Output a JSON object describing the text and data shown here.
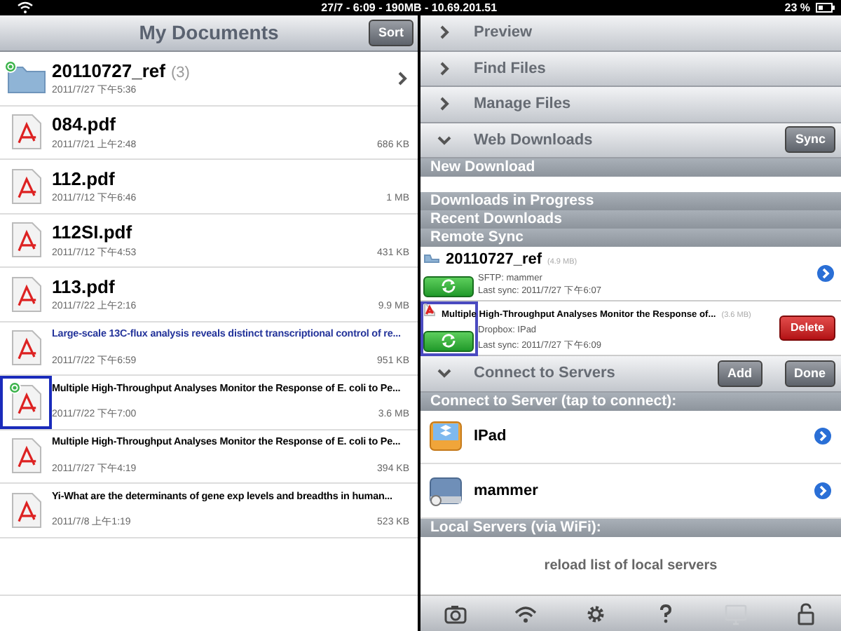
{
  "status_bar": {
    "time": "27/7 - 6:09 - 190MB - 10.69.201.51",
    "battery": "23 %"
  },
  "documents": {
    "title": "My Documents",
    "sort_button": "Sort",
    "items": [
      {
        "kind": "folder",
        "name": "20110727_ref",
        "count": "(3)",
        "date": "2011/7/27 下午5:36",
        "synced": true,
        "selected": false,
        "highlighted": false
      },
      {
        "kind": "pdf",
        "name": "084.pdf",
        "date": "2011/7/21 上午2:48",
        "size": "686 KB",
        "synced": false,
        "selected": false,
        "highlighted": false
      },
      {
        "kind": "pdf",
        "name": "112.pdf",
        "date": "2011/7/12 下午6:46",
        "size": "1 MB",
        "synced": false,
        "selected": false,
        "highlighted": false
      },
      {
        "kind": "pdf",
        "name": "112SI.pdf",
        "date": "2011/7/12 下午4:53",
        "size": "431 KB",
        "synced": false,
        "selected": false,
        "highlighted": false
      },
      {
        "kind": "pdf",
        "name": "113.pdf",
        "date": "2011/7/22 上午2:16",
        "size": "9.9 MB",
        "synced": false,
        "selected": false,
        "highlighted": false
      },
      {
        "kind": "pdf",
        "name": "Large-scale 13C-flux analysis reveals distinct transcriptional control of re...",
        "date": "2011/7/22 下午6:59",
        "size": "951 KB",
        "synced": false,
        "selected": false,
        "highlighted": true
      },
      {
        "kind": "pdf",
        "name": "Multiple High-Throughput Analyses Monitor the Response of E. coli to Pe...",
        "date": "2011/7/22 下午7:00",
        "size": "3.6 MB",
        "synced": true,
        "selected": true,
        "highlighted": false
      },
      {
        "kind": "pdf",
        "name": "Multiple High-Throughput Analyses Monitor the Response of E. coli to Pe...",
        "date": "2011/7/27 下午4:19",
        "size": "394 KB",
        "synced": false,
        "selected": false,
        "highlighted": false
      },
      {
        "kind": "pdf",
        "name": "Yi-What are the determinants of gene exp levels and breadths in human...",
        "date": "2011/7/8 上午1:19",
        "size": "523 KB",
        "synced": false,
        "selected": false,
        "highlighted": false
      }
    ]
  },
  "panels": [
    {
      "label": "Preview",
      "expanded": false
    },
    {
      "label": "Find Files",
      "expanded": false
    },
    {
      "label": "Manage Files",
      "expanded": false
    },
    {
      "label": "Web Downloads",
      "expanded": true,
      "button": "Sync"
    }
  ],
  "web_downloads": {
    "sections": [
      "New Download",
      "Downloads in Progress",
      "Recent Downloads",
      "Remote Sync"
    ],
    "sync_items": [
      {
        "kind": "folder",
        "name": "20110727_ref",
        "size": "(4.9 MB)",
        "server": "SFTP: mammer",
        "last_sync": "Last sync: 2011/7/27 下午6:07",
        "selected": false
      },
      {
        "kind": "pdf",
        "name": "Multiple High-Throughput Analyses Monitor the Response of...",
        "size": "(3.6 MB)",
        "server": "Dropbox: IPad",
        "last_sync": "Last sync: 2011/7/27 下午6:09",
        "selected": true,
        "delete_button": "Delete"
      }
    ]
  },
  "servers": {
    "label": "Connect to Servers",
    "expanded": true,
    "buttons": [
      "Add",
      "Done"
    ],
    "section": "Connect to Server (tap to connect):",
    "items": [
      {
        "kind": "dropbox",
        "name": "IPad"
      },
      {
        "kind": "drive",
        "name": "mammer"
      }
    ],
    "local_section": "Local Servers (via WiFi):",
    "reload": "reload list of local servers"
  },
  "toolbar": [
    {
      "kind": "camera",
      "disabled": false
    },
    {
      "kind": "wifi",
      "disabled": false
    },
    {
      "kind": "gear",
      "disabled": false
    },
    {
      "kind": "help",
      "disabled": false
    },
    {
      "kind": "monitor",
      "disabled": true
    },
    {
      "kind": "lock",
      "disabled": false
    }
  ]
}
